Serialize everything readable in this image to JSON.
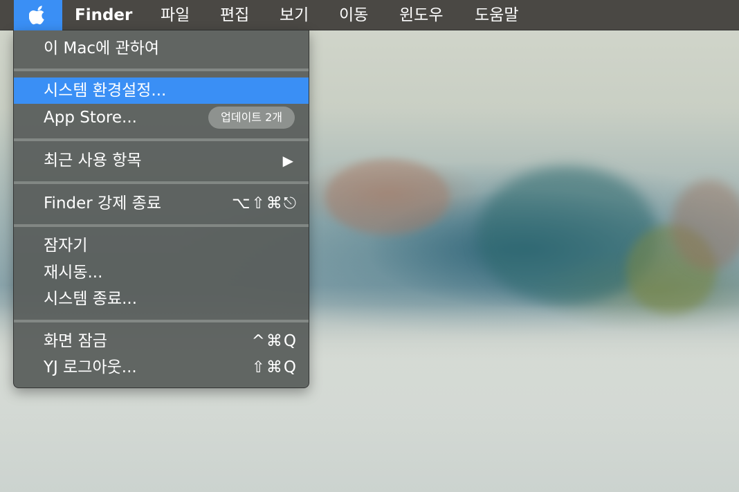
{
  "menubar": {
    "apple_icon": "apple-logo-icon",
    "app_name": "Finder",
    "items": [
      "파일",
      "편집",
      "보기",
      "이동",
      "윈도우",
      "도움말"
    ]
  },
  "apple_menu": {
    "about": "이 Mac에 관하여",
    "system_preferences": "시스템 환경설정...",
    "app_store": "App Store...",
    "app_store_badge": "업데이트 2개",
    "recent_items": "최근 사용 항목",
    "submenu_arrow": "▶",
    "force_quit": "Finder 강제 종료",
    "force_quit_shortcut": "⌥⇧⌘⎋",
    "sleep": "잠자기",
    "restart": "재시동...",
    "shutdown": "시스템 종료...",
    "lock_screen": "화면 잠금",
    "lock_screen_shortcut": "^⌘Q",
    "logout": "YJ 로그아웃...",
    "logout_shortcut": "⇧⌘Q"
  },
  "colors": {
    "highlight": "#3a8ff5",
    "menubar_bg": "#4a4844",
    "menu_bg": "#585c5a"
  }
}
